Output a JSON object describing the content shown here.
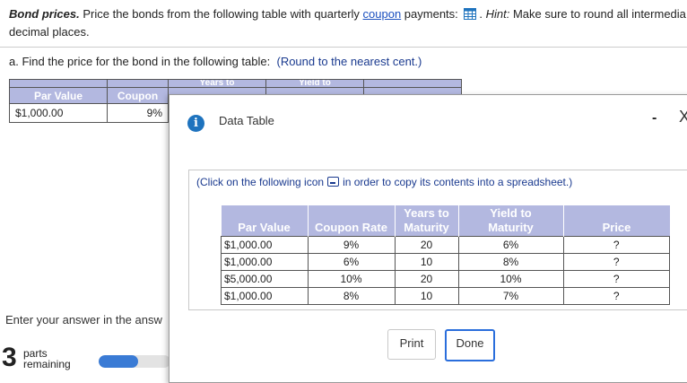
{
  "problem": {
    "title": "Bond prices.",
    "text_before_link": " Price the bonds from the following table with quarterly ",
    "link": "coupon",
    "text_after_link": " payments: ",
    "hint_label": "Hint:",
    "hint_text": " Make sure to round all intermedia",
    "line2": "decimal places."
  },
  "part_a": {
    "label": "a. Find the price for the bond in the following table:",
    "instruction": "(Round to the nearest cent.)"
  },
  "bg_table": {
    "top_headers": [
      "Years to",
      "Yield to"
    ],
    "headers": [
      "Par Value",
      "Coupon"
    ],
    "row": [
      "$1,000.00",
      "9%"
    ]
  },
  "enter_text": "Enter your answer in the answ",
  "parts": {
    "count": "3",
    "label1": "parts",
    "label2": "remaining",
    "progress_fraction": 0.55
  },
  "modal": {
    "title": "Data Table",
    "copy_before": "(Click on the following icon",
    "copy_after": "in order to copy its contents into a spreadsheet.)",
    "headers": [
      "Par Value",
      "Coupon Rate",
      "Years to Maturity",
      "Yield to Maturity",
      "Price"
    ],
    "header_line1": [
      "",
      "",
      "Years to",
      "Yield to",
      ""
    ],
    "header_line2": [
      "Par Value",
      "Coupon Rate",
      "Maturity",
      "Maturity",
      "Price"
    ],
    "rows": [
      [
        "$1,000.00",
        "9%",
        "20",
        "6%",
        "?"
      ],
      [
        "$1,000.00",
        "6%",
        "10",
        "8%",
        "?"
      ],
      [
        "$5,000.00",
        "10%",
        "20",
        "10%",
        "?"
      ],
      [
        "$1,000.00",
        "8%",
        "10",
        "7%",
        "?"
      ]
    ],
    "print_label": "Print",
    "done_label": "Done",
    "close_glyph": "X",
    "minimize_glyph": "-"
  },
  "icons": [
    "table-grid-icon",
    "info-icon",
    "copy-icon",
    "minimize-icon",
    "close-icon"
  ],
  "colors": {
    "header_bg": "#b3b8e0",
    "link": "#1a4fbf",
    "accent": "#2a6edc",
    "info": "#1e73be"
  }
}
